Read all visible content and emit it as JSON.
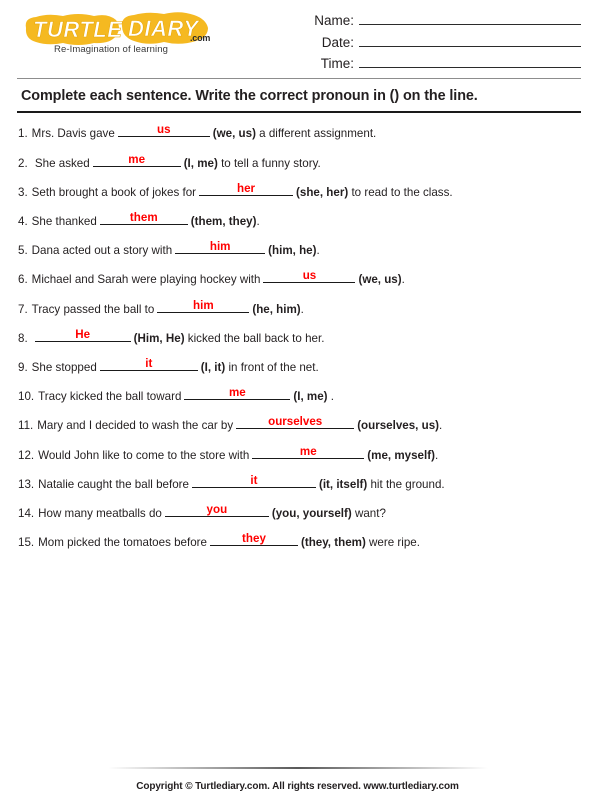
{
  "brand": {
    "logo_text": "TURTLE DIARY",
    "logo_word_1": "TURTLE",
    "logo_word_2": "DIARY",
    "dotcom": ".com",
    "tagline": "Re-Imagination of learning",
    "logo_color": "#f5b921",
    "logo_letter_color": "#ffffff"
  },
  "header": {
    "fields": [
      {
        "label": "Name:"
      },
      {
        "label": "Date:"
      },
      {
        "label": "Time:"
      }
    ]
  },
  "instruction": {
    "text": "Complete each sentence. Write the correct pronoun in () on the line."
  },
  "answer_color": "#ff0000",
  "questions": [
    {
      "num": "1.",
      "before": "Mrs. Davis gave",
      "answer": "us",
      "blank_width": 92,
      "choices": "(we, us)",
      "after": " a different assignment."
    },
    {
      "num": "2.",
      "before": " She asked",
      "answer": "me",
      "blank_width": 88,
      "choices": "(I, me)",
      "after": " to tell a funny story."
    },
    {
      "num": "3.",
      "before": "Seth brought a book of jokes for",
      "answer": "her",
      "blank_width": 94,
      "choices": "(she, her)",
      "after": " to read to the class."
    },
    {
      "num": "4.",
      "before": "She thanked",
      "answer": "them",
      "blank_width": 88,
      "choices": "(them, they)",
      "after": "."
    },
    {
      "num": "5.",
      "before": "Dana acted out a story with",
      "answer": "him",
      "blank_width": 90,
      "choices": "(him, he)",
      "after": "."
    },
    {
      "num": "6.",
      "before": "Michael and Sarah were playing hockey with",
      "answer": "us",
      "blank_width": 92,
      "choices": "(we, us)",
      "after": "."
    },
    {
      "num": "7.",
      "before": "Tracy passed the ball to",
      "answer": "him",
      "blank_width": 92,
      "choices": "(he, him)",
      "after": "."
    },
    {
      "num": "8.",
      "before": "",
      "answer": "He",
      "blank_width": 96,
      "choices": "(Him, He)",
      "after": " kicked the ball back to her."
    },
    {
      "num": "9.",
      "before": "She stopped",
      "answer": "it",
      "blank_width": 98,
      "choices": "(I, it)",
      "after": " in front of the net."
    },
    {
      "num": "10.",
      "before": "Tracy kicked the ball toward",
      "answer": "me",
      "blank_width": 106,
      "choices": "(I, me)",
      "after": " ."
    },
    {
      "num": "11.",
      "before": "Mary and I decided to wash the car by",
      "answer": "ourselves",
      "blank_width": 118,
      "choices": "(ourselves, us)",
      "after": "."
    },
    {
      "num": "12.",
      "before": "Would John like to come to the store with",
      "answer": "me",
      "blank_width": 112,
      "choices": "(me, myself)",
      "after": "."
    },
    {
      "num": "13.",
      "before": "Natalie caught the ball before",
      "answer": "it",
      "blank_width": 124,
      "choices": "(it, itself)",
      "after": " hit the ground."
    },
    {
      "num": "14.",
      "before": "How many meatballs do",
      "answer": "you",
      "blank_width": 104,
      "choices": "(you, yourself)",
      "after": " want?"
    },
    {
      "num": "15.",
      "before": "Mom picked the tomatoes before",
      "answer": "they",
      "blank_width": 88,
      "choices": "(they, them)",
      "after": " were ripe."
    }
  ],
  "footer": {
    "copyright": "Copyright © Turtlediary.com. All rights reserved. www.turtlediary.com"
  }
}
